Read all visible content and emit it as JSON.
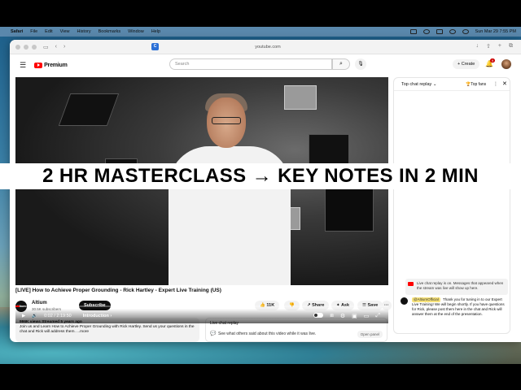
{
  "menubar": {
    "app": "Safari",
    "items": [
      "File",
      "Edit",
      "View",
      "History",
      "Bookmarks",
      "Window",
      "Help"
    ],
    "clock": "Sun Mar 29  7:55 PM"
  },
  "browser": {
    "url": "youtube.com",
    "tab_icon": "C"
  },
  "youtube": {
    "logo_text": "Premium",
    "search_placeholder": "Search",
    "create_label": "+ Create",
    "notification_count": "9"
  },
  "video": {
    "overlay_title": "2 HR MASTERCLASS → KEY NOTES IN 2 MIN",
    "time": "0:02 / 2:19:50",
    "chapter": "Introduction ›",
    "progress_fraction": 0.01,
    "title": "[LIVE] How to Achieve Proper Grounding - Rick Hartley - Expert Live Training (US)"
  },
  "channel": {
    "avatar_text": "Altium",
    "name": "Altium",
    "subscribers": "30.5K subscribers",
    "subscribe_label": "Subscribe",
    "likes": "11K",
    "share_label": "Share",
    "ask_label": "Ask",
    "save_label": "Save",
    "more_label": "···"
  },
  "description": {
    "meta": "996K views  Streamed 5 years ago",
    "text": "Join us and Learn How to Achieve Proper Grounding with Rick Hartley. Send us your questions in the chat and Rick will address them.",
    "more": "...more"
  },
  "live_replay_box": {
    "title": "Live chat replay",
    "text": "See what others said about this video while it was live.",
    "open_panel": "Open panel"
  },
  "chat": {
    "header": "Top chat replay",
    "top_fans": "Top fans",
    "replay_note": "Live chat replay is on. Messages that appeared when the stream was live will show up here.",
    "message_author": "@AltiumOfficial",
    "message_text": "Thank you for tuning in to our Expert Live Training! We will begin shortly. If you have questions for Rick, please post them here in the chat and Rick will answer them at the end of the presentation."
  },
  "colors": {
    "youtube_red": "#ff0000",
    "subscribe_bg": "#0f0f0f",
    "author_highlight": "#f8e37a"
  }
}
